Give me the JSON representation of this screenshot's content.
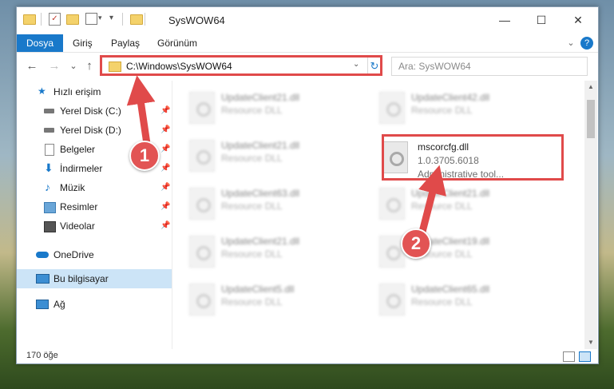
{
  "window": {
    "title": "SysWOW64",
    "minimize_glyph": "—",
    "maximize_glyph": "☐",
    "close_glyph": "✕"
  },
  "ribbon": {
    "tabs": [
      {
        "label": "Dosya",
        "active": true
      },
      {
        "label": "Giriş"
      },
      {
        "label": "Paylaş"
      },
      {
        "label": "Görünüm"
      }
    ],
    "expand_glyph": "⌄",
    "help_glyph": "?"
  },
  "nav": {
    "back_glyph": "←",
    "forward_glyph": "→",
    "recent_glyph": "⌄",
    "up_glyph": "↑",
    "address": "C:\\Windows\\SysWOW64",
    "refresh_glyph": "↻",
    "search_placeholder": "Ara: SysWOW64"
  },
  "sidebar": {
    "items": [
      {
        "label": "Hızlı erişim",
        "icon": "star-icon",
        "pinned": false
      },
      {
        "label": "Yerel Disk (C:)",
        "icon": "drive-icon",
        "pinned": true
      },
      {
        "label": "Yerel Disk (D:)",
        "icon": "drive-icon",
        "pinned": true
      },
      {
        "label": "Belgeler",
        "icon": "document-icon",
        "pinned": true
      },
      {
        "label": "İndirmeler",
        "icon": "download-icon",
        "pinned": true
      },
      {
        "label": "Müzik",
        "icon": "music-icon",
        "pinned": true
      },
      {
        "label": "Resimler",
        "icon": "pictures-icon",
        "pinned": true
      },
      {
        "label": "Videolar",
        "icon": "video-icon",
        "pinned": true
      },
      {
        "label": "OneDrive",
        "icon": "cloud-icon",
        "pinned": false
      },
      {
        "label": "Bu bilgisayar",
        "icon": "computer-icon",
        "pinned": false,
        "selected": true
      },
      {
        "label": "Ağ",
        "icon": "network-icon",
        "pinned": false
      }
    ],
    "pin_glyph": "📌"
  },
  "files": [
    {
      "name": "UpdateClient21.dll",
      "type": "Resource DLL",
      "blurred": true
    },
    {
      "name": "UpdateClient42.dll",
      "type": "Resource DLL",
      "blurred": true
    },
    {
      "name": "UpdateClient21.dll",
      "type": "Resource DLL",
      "blurred": true
    },
    {
      "name": "mscorcfg.dll",
      "version": "1.0.3705.6018",
      "type": "Administrative tool...",
      "blurred": false,
      "highlighted": true
    },
    {
      "name": "UpdateClient63.dll",
      "type": "Resource DLL",
      "blurred": true
    },
    {
      "name": "UpdateClient21.dll",
      "type": "Resource DLL",
      "blurred": true
    },
    {
      "name": "UpdateClient21.dll",
      "type": "Resource DLL",
      "blurred": true
    },
    {
      "name": "UpdateClient19.dll",
      "type": "Resource DLL",
      "blurred": true
    },
    {
      "name": "UpdateClient5.dll",
      "type": "Resource DLL",
      "blurred": true
    },
    {
      "name": "UpdateClient65.dll",
      "type": "Resource DLL",
      "blurred": true
    }
  ],
  "status": {
    "item_count": "170 öğe"
  },
  "annotations": {
    "badge1": "1",
    "badge2": "2",
    "color": "#e04a4a"
  },
  "colors": {
    "accent": "#1979ca",
    "selection": "#cce4f7"
  }
}
